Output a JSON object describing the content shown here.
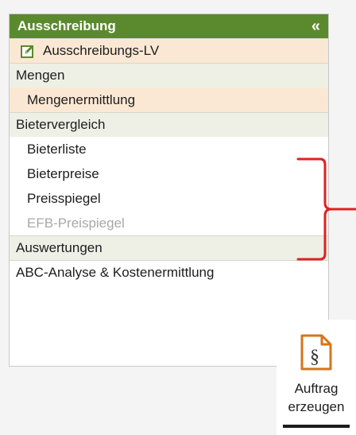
{
  "panel": {
    "title": "Ausschreibung",
    "collapse_glyph": "«",
    "items": [
      {
        "label": "Ausschreibungs-LV",
        "icon": "edit-icon",
        "type": "sub-active-icon"
      },
      {
        "label": "Mengen",
        "type": "section"
      },
      {
        "label": "Mengenermittlung",
        "type": "sub-active"
      },
      {
        "label": "Bietervergleich",
        "type": "section"
      },
      {
        "label": "Bieterliste",
        "type": "sub"
      },
      {
        "label": "Bieterpreise",
        "type": "sub"
      },
      {
        "label": "Preisspiegel",
        "type": "sub"
      },
      {
        "label": "EFB-Preispiegel",
        "type": "sub-disabled"
      },
      {
        "label": "Auswertungen",
        "type": "section"
      },
      {
        "label": "ABC-Analyse & Kostenermittlung",
        "type": "plain"
      }
    ]
  },
  "auftrag_button": {
    "line1": "Auftrag",
    "line2": "erzeugen",
    "icon": "paragraph-document-icon"
  },
  "colors": {
    "header_bg": "#5a8a2d",
    "section_bg": "#eef0e6",
    "active_bg": "#fbe8d4",
    "bracket": "#e02020",
    "icon_orange": "#d4761a",
    "edit_icon_green": "#5a8a2d"
  }
}
